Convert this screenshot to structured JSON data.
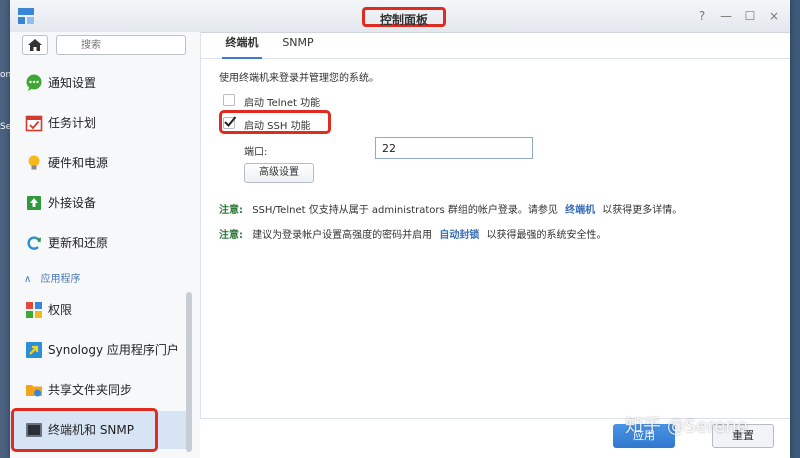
{
  "window": {
    "title": "控制面板"
  },
  "desktop": {
    "edge_label": "on",
    "edge_label2": "Se"
  },
  "window_buttons": {
    "help": "?",
    "minimize": "—",
    "maximize": "☐",
    "close": "×"
  },
  "sidebar": {
    "search_placeholder": "搜索",
    "items": [
      {
        "label": "通知设置",
        "icon": "chat-bubble-icon"
      },
      {
        "label": "任务计划",
        "icon": "calendar-check-icon"
      },
      {
        "label": "硬件和电源",
        "icon": "lightbulb-icon"
      },
      {
        "label": "外接设备",
        "icon": "upload-drive-icon"
      },
      {
        "label": "更新和还原",
        "icon": "refresh-icon"
      }
    ],
    "section_label": "应用程序",
    "section_chevron": "∧",
    "app_items": [
      {
        "label": "权限",
        "icon": "grid-permission-icon"
      },
      {
        "label": "Synology 应用程序门户",
        "icon": "portal-arrow-icon"
      },
      {
        "label": "共享文件夹同步",
        "icon": "folder-sync-icon"
      },
      {
        "label": "终端机和 SNMP",
        "icon": "terminal-icon"
      }
    ]
  },
  "tabs": [
    {
      "label": "终端机"
    },
    {
      "label": "SNMP"
    }
  ],
  "content": {
    "description": "使用终端机来登录并管理您的系统。",
    "telnet_label": "启动 Telnet 功能",
    "telnet_checked": false,
    "ssh_label": "启动 SSH 功能",
    "ssh_checked": true,
    "port_label": "端口:",
    "port_value": "22",
    "advanced_button": "高级设置",
    "note1_key": "注意:",
    "note1_text_a": "SSH/Telnet 仅支持从属于 administrators 群组的帐户登录。请参见",
    "note1_link": "终端机",
    "note1_text_b": "以获得更多详情。",
    "note2_key": "注意:",
    "note2_text_a": "建议为登录帐户设置高强度的密码并启用",
    "note2_link": "自动封锁",
    "note2_text_b": "以获得最强的系统安全性。"
  },
  "footer": {
    "apply": "应用",
    "reset": "重置"
  },
  "watermark": "知乎 @Serene"
}
